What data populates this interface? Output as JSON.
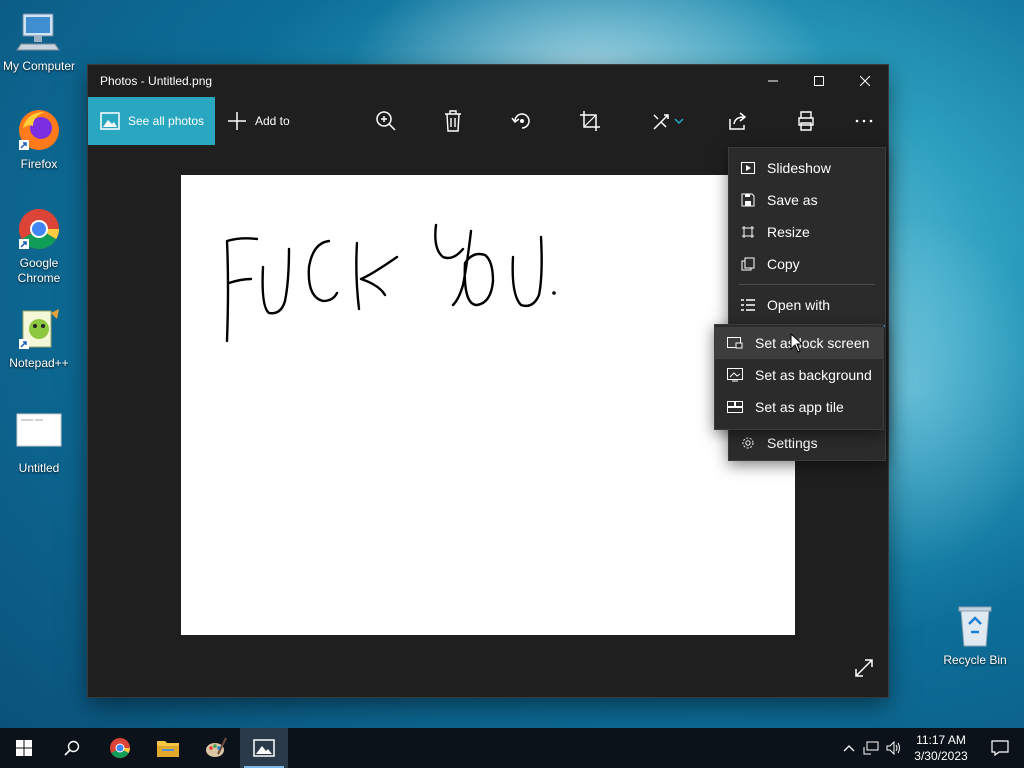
{
  "desktop": {
    "icons": [
      {
        "label": "My Computer"
      },
      {
        "label": "Firefox"
      },
      {
        "label": "Google Chrome"
      },
      {
        "label": "Notepad++"
      },
      {
        "label": "Untitled"
      },
      {
        "label": "Recycle Bin"
      }
    ]
  },
  "window": {
    "title": "Photos - Untitled.png",
    "toolbar": {
      "see_all_label": "See all photos",
      "add_to_label": "Add to",
      "icons": [
        "zoom-in-icon",
        "delete-icon",
        "rotate-icon",
        "crop-icon",
        "edit-icon",
        "share-icon",
        "print-icon",
        "more-icon"
      ]
    },
    "image_text": "FUCK YOU"
  },
  "menu": {
    "items": [
      {
        "label": "Slideshow",
        "icon": "slideshow-icon"
      },
      {
        "label": "Save as",
        "icon": "save-icon"
      },
      {
        "label": "Resize",
        "icon": "resize-icon"
      },
      {
        "label": "Copy",
        "icon": "copy-icon"
      },
      {
        "label": "Open with",
        "icon": "open-with-icon"
      },
      {
        "label": "Settings",
        "icon": "settings-icon"
      }
    ]
  },
  "submenu": {
    "items": [
      {
        "label": "Set as lock screen",
        "icon": "lock-screen-icon"
      },
      {
        "label": "Set as background",
        "icon": "background-icon"
      },
      {
        "label": "Set as app tile",
        "icon": "app-tile-icon"
      }
    ]
  },
  "taskbar": {
    "time": "11:17 AM",
    "date": "3/30/2023",
    "accent": "#2aa7c0"
  }
}
